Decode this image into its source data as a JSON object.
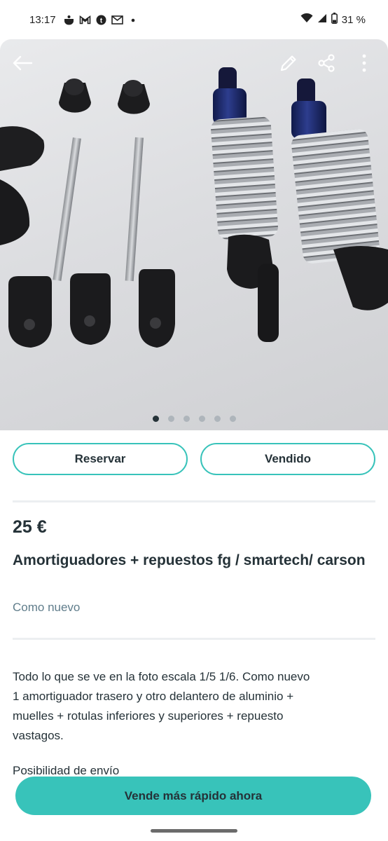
{
  "status_bar": {
    "time": "13:17",
    "battery": "31 %",
    "left_icons": [
      "cooking-pot-icon",
      "gmail-icon",
      "tumblr-icon",
      "outlook-icon",
      "dot-icon"
    ],
    "right_icons": [
      "wifi-icon",
      "signal-icon",
      "battery-icon"
    ]
  },
  "gallery": {
    "total_images": 6,
    "active_index": 0,
    "toolbar_icons": [
      "back-arrow-icon",
      "edit-pencil-icon",
      "share-icon",
      "more-vertical-icon"
    ]
  },
  "actions": {
    "reserve_label": "Reservar",
    "sold_label": "Vendido"
  },
  "listing": {
    "price": "25 €",
    "title": "Amortiguadores + repuestos fg / smartech/ carson",
    "condition": "Como nuevo",
    "description": "Todo lo que se ve en la foto escala 1/5 1/6. Como nuevo\n1 amortiguador trasero y otro delantero de aluminio +\nmuelles + rotulas inferiores y superiores + repuesto\nvastagos.",
    "shipping": "Posibilidad de envío"
  },
  "cta": {
    "label": "Vende más rápido ahora"
  },
  "colors": {
    "accent": "#38c3ba",
    "text": "#253238",
    "muted": "#607d8b"
  }
}
